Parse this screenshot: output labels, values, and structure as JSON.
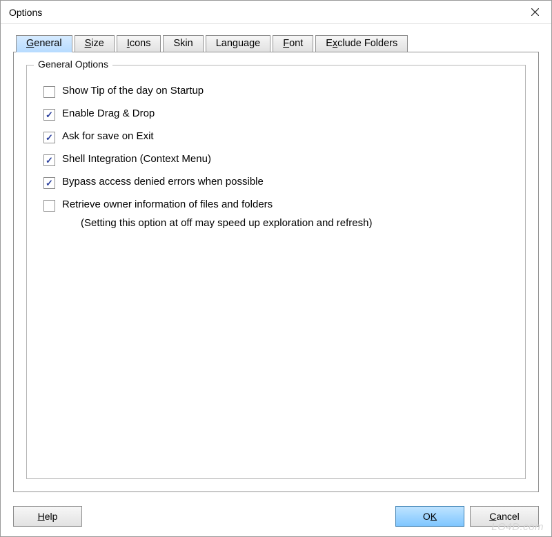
{
  "window": {
    "title": "Options"
  },
  "tabs": [
    {
      "pre": "",
      "u": "G",
      "post": "eneral",
      "active": true
    },
    {
      "pre": "",
      "u": "S",
      "post": "ize",
      "active": false
    },
    {
      "pre": "",
      "u": "I",
      "post": "cons",
      "active": false
    },
    {
      "pre": "Skin",
      "u": "",
      "post": "",
      "active": false
    },
    {
      "pre": "Language",
      "u": "",
      "post": "",
      "active": false
    },
    {
      "pre": "",
      "u": "F",
      "post": "ont",
      "active": false
    },
    {
      "pre": "E",
      "u": "x",
      "post": "clude Folders",
      "active": false
    }
  ],
  "panel": {
    "legend": "General Options",
    "options": [
      {
        "checked": false,
        "pre": "Sh",
        "u": "o",
        "post": "w Tip of the day on Startup",
        "sub": ""
      },
      {
        "checked": true,
        "pre": "Enable ",
        "u": "D",
        "post": "rag & Drop",
        "sub": ""
      },
      {
        "checked": true,
        "pre": "",
        "u": "A",
        "post": "sk for save on Exit",
        "sub": ""
      },
      {
        "checked": true,
        "pre": "Shell Integration (Context Menu)",
        "u": "",
        "post": "",
        "sub": ""
      },
      {
        "checked": true,
        "pre": "",
        "u": "B",
        "post": "ypass access denied errors when possible",
        "sub": ""
      },
      {
        "checked": false,
        "pre": "",
        "u": "R",
        "post": "etrieve owner information of files and folders",
        "sub": "(Setting this option at off may speed up exploration and refresh)"
      }
    ]
  },
  "buttons": {
    "help": {
      "pre": "",
      "u": "H",
      "post": "elp"
    },
    "ok": {
      "pre": "O",
      "u": "K",
      "post": ""
    },
    "cancel": {
      "pre": "",
      "u": "C",
      "post": "ancel"
    }
  },
  "watermark": "LO4D.com"
}
